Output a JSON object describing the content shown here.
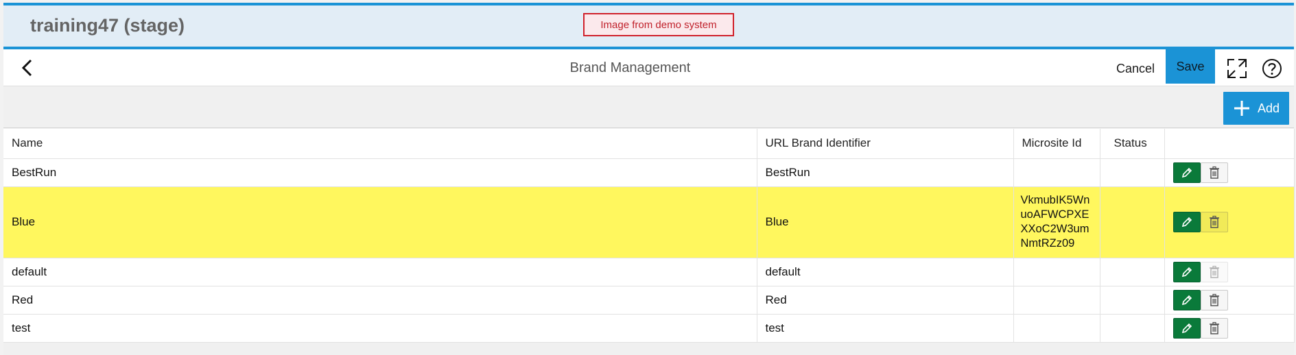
{
  "shell": {
    "system_title": "training47 (stage)",
    "demo_badge": "Image from demo system"
  },
  "header": {
    "title": "Brand Management",
    "cancel_label": "Cancel",
    "save_label": "Save"
  },
  "toolbar": {
    "add_label": "Add"
  },
  "table": {
    "columns": [
      "Name",
      "URL Brand Identifier",
      "Microsite Id",
      "Status",
      ""
    ],
    "rows": [
      {
        "name": "BestRun",
        "url": "BestRun",
        "microsite": "",
        "status": "",
        "delete_enabled": true,
        "highlighted": false
      },
      {
        "name": "Blue",
        "url": "Blue",
        "microsite": "VkmubIK5WnuoAFWCPXEXXoC2W3umNmtRZz09",
        "status": "",
        "delete_enabled": true,
        "highlighted": true
      },
      {
        "name": "default",
        "url": "default",
        "microsite": "",
        "status": "",
        "delete_enabled": false,
        "highlighted": false
      },
      {
        "name": "Red",
        "url": "Red",
        "microsite": "",
        "status": "",
        "delete_enabled": true,
        "highlighted": false
      },
      {
        "name": "test",
        "url": "test",
        "microsite": "",
        "status": "",
        "delete_enabled": true,
        "highlighted": false
      }
    ]
  },
  "colors": {
    "accent": "#1b93d6",
    "highlight_row": "#fff75e",
    "edit_button": "#0a7a3a",
    "badge_border": "#d0202a"
  },
  "icons": {
    "back": "chevron-left-icon",
    "fullscreen": "expand-icon",
    "help": "help-icon",
    "add": "plus-icon",
    "edit": "pencil-icon",
    "delete": "trash-icon"
  }
}
